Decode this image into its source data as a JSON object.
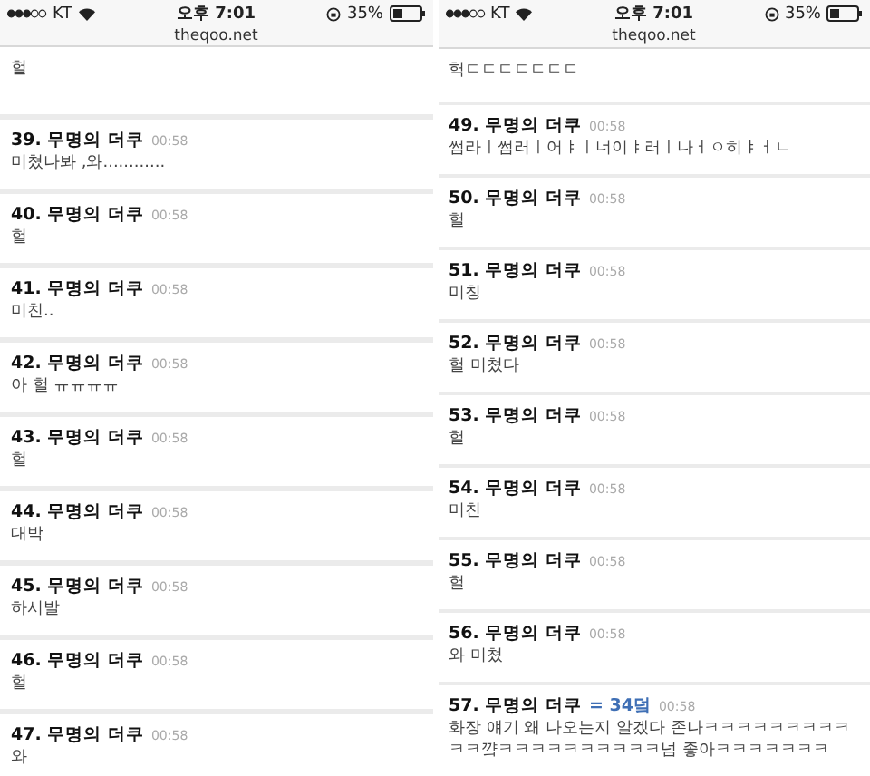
{
  "phones": [
    {
      "status": {
        "carrier": "KT",
        "time": "오후 7:01",
        "battery": "35%"
      },
      "url": "theqoo.net",
      "comments": [
        {
          "kind": "tail",
          "text": "헐"
        },
        {
          "kind": "comment",
          "number": "39.",
          "author": "무명의 더쿠",
          "time": "00:58",
          "text": "미쳤나봐 ,와............"
        },
        {
          "kind": "comment",
          "number": "40.",
          "author": "무명의 더쿠",
          "time": "00:58",
          "text": "헐"
        },
        {
          "kind": "comment",
          "number": "41.",
          "author": "무명의 더쿠",
          "time": "00:58",
          "text": "미친.."
        },
        {
          "kind": "comment",
          "number": "42.",
          "author": "무명의 더쿠",
          "time": "00:58",
          "text": "아 헐 ㅠㅠㅠㅠ"
        },
        {
          "kind": "comment",
          "number": "43.",
          "author": "무명의 더쿠",
          "time": "00:58",
          "text": "헐"
        },
        {
          "kind": "comment",
          "number": "44.",
          "author": "무명의 더쿠",
          "time": "00:58",
          "text": "대박"
        },
        {
          "kind": "comment",
          "number": "45.",
          "author": "무명의 더쿠",
          "time": "00:58",
          "text": "하시발"
        },
        {
          "kind": "comment",
          "number": "46.",
          "author": "무명의 더쿠",
          "time": "00:58",
          "text": "헐"
        },
        {
          "kind": "comment",
          "number": "47.",
          "author": "무명의 더쿠",
          "time": "00:58",
          "text": "와"
        }
      ]
    },
    {
      "status": {
        "carrier": "KT",
        "time": "오후 7:01",
        "battery": "35%"
      },
      "url": "theqoo.net",
      "comments": [
        {
          "kind": "tail",
          "text": "헉ㄷㄷㄷㄷㄷㄷㄷ"
        },
        {
          "kind": "comment",
          "number": "49.",
          "author": "무명의 더쿠",
          "time": "00:58",
          "text": "썸라ㅣ썸러ㅣ어ㅑㅣ너이ㅑ러ㅣ나ㅓㅇ히ㅑㅓㄴ"
        },
        {
          "kind": "comment",
          "number": "50.",
          "author": "무명의 더쿠",
          "time": "00:58",
          "text": "헐"
        },
        {
          "kind": "comment",
          "number": "51.",
          "author": "무명의 더쿠",
          "time": "00:58",
          "text": "미칭"
        },
        {
          "kind": "comment",
          "number": "52.",
          "author": "무명의 더쿠",
          "time": "00:58",
          "text": "헐 미쳤다"
        },
        {
          "kind": "comment",
          "number": "53.",
          "author": "무명의 더쿠",
          "time": "00:58",
          "text": "헐"
        },
        {
          "kind": "comment",
          "number": "54.",
          "author": "무명의 더쿠",
          "time": "00:58",
          "text": "미친"
        },
        {
          "kind": "comment",
          "number": "55.",
          "author": "무명의 더쿠",
          "time": "00:58",
          "text": "헐"
        },
        {
          "kind": "comment",
          "number": "56.",
          "author": "무명의 더쿠",
          "time": "00:58",
          "text": "와 미쳤"
        },
        {
          "kind": "comment",
          "number": "57.",
          "author": "무명의 더쿠",
          "badge": "= 34덬",
          "time": "00:58",
          "text": "화장 얘기 왜 나오는지 알겠다 존나ㅋㅋㅋㅋㅋㅋㅋㅋㅋㅋㅋ꺜ㅋㅋㅋㅋㅋㅋㅋㅋㅋㅋ넘 좋아ㅋㅋㅋㅋㅋㅋㅋ"
        }
      ]
    }
  ]
}
